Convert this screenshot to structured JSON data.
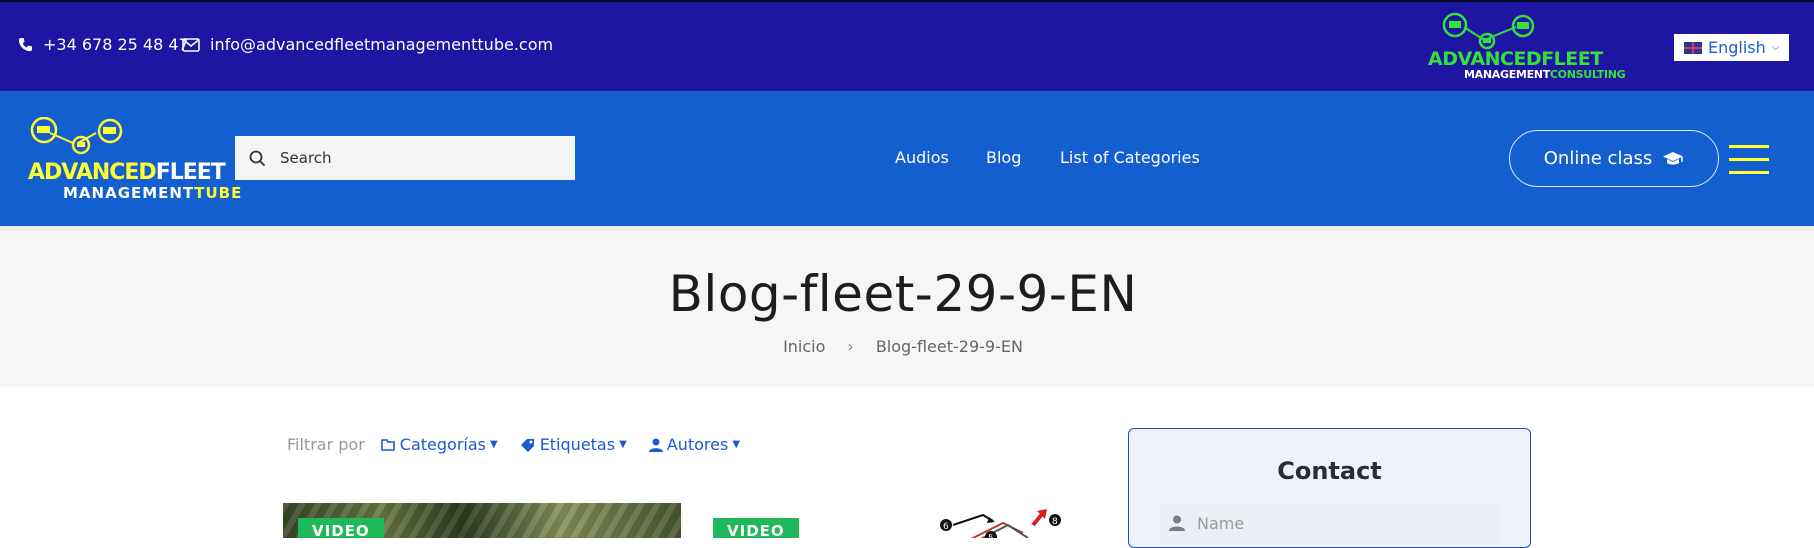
{
  "topbar": {
    "phone": "+34 678 25 48 47",
    "email": "info@advancedfleetmanagementtube.com",
    "brand_line1": "ADVANCEDFLEET",
    "brand_line2_a": "MANAGEMENT",
    "brand_line2_b": "CONSULTING",
    "language": "English",
    "colors": {
      "background": "#1f15a3",
      "brand_green": "#34e03a"
    }
  },
  "header": {
    "logo_line1_a": "ADVANCED",
    "logo_line1_b": "FLEET",
    "logo_line2_a": "MANAGEMENT",
    "logo_line2_b": "TUBE",
    "search_placeholder": "Search",
    "nav": [
      "Audios",
      "Blog",
      "List of Categories"
    ],
    "online_class": "Online class",
    "colors": {
      "background": "#135fcf",
      "accent": "#ffff33"
    }
  },
  "page": {
    "title": "Blog-fleet-29-9-EN",
    "breadcrumb": [
      "Inicio",
      "Blog-fleet-29-9-EN"
    ]
  },
  "filter": {
    "label": "Filtrar por",
    "categories": "Categorías",
    "tags": "Etiquetas",
    "authors": "Autores"
  },
  "cards": [
    {
      "tag": "VIDEO"
    },
    {
      "tag": "VIDEO"
    }
  ],
  "contact": {
    "title": "Contact",
    "name_placeholder": "Name"
  },
  "icons": [
    "phone-icon",
    "mail-icon",
    "truck-network-icon",
    "flag-uk-icon",
    "chevron-down-icon",
    "search-icon",
    "graduation-cap-icon",
    "menu-icon",
    "folder-tag-icon",
    "tag-icon",
    "user-icon"
  ]
}
